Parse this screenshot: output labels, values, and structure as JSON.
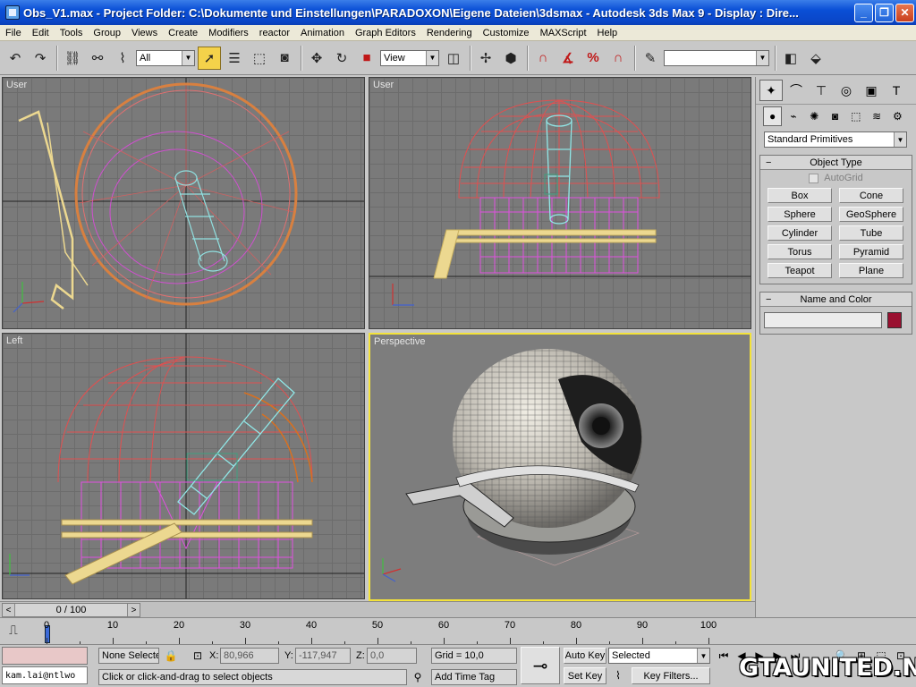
{
  "window": {
    "title": "Obs_V1.max   - Project Folder: C:\\Dokumente und Einstellungen\\PARADOXON\\Eigene Dateien\\3dsmax    - Autodesk 3ds Max 9    - Display : Dire..."
  },
  "menu": [
    "File",
    "Edit",
    "Tools",
    "Group",
    "Views",
    "Create",
    "Modifiers",
    "reactor",
    "Animation",
    "Graph Editors",
    "Rendering",
    "Customize",
    "MAXScript",
    "Help"
  ],
  "toolbar": {
    "selection_filter": "All",
    "reference_coord": "View",
    "named_selection": ""
  },
  "viewports": {
    "top_left": "User",
    "top_right": "User",
    "bottom_left": "Left",
    "bottom_right": "Perspective"
  },
  "command_panel": {
    "category_dropdown": "Standard Primitives",
    "object_type_title": "Object Type",
    "autogrid_label": "AutoGrid",
    "primitives": [
      "Box",
      "Cone",
      "Sphere",
      "GeoSphere",
      "Cylinder",
      "Tube",
      "Torus",
      "Pyramid",
      "Teapot",
      "Plane"
    ],
    "name_color_title": "Name and Color",
    "object_name": "",
    "object_color": "#9a1030"
  },
  "timeline": {
    "slider_text": "0 / 100",
    "ticks": [
      "0",
      "10",
      "20",
      "30",
      "40",
      "50",
      "60",
      "70",
      "80",
      "90",
      "100"
    ]
  },
  "status": {
    "maxscript_user": "kam.lai@ntlwo",
    "selection": "None Selecte",
    "x_label": "X:",
    "x_value": "80,966",
    "y_label": "Y:",
    "y_value": "-117,947",
    "z_label": "Z:",
    "z_value": "0,0",
    "grid": "Grid = 10,0",
    "prompt": "Click or click-and-drag to select objects",
    "add_time_tag": "Add Time Tag",
    "auto_key": "Auto Key",
    "set_key": "Set Key",
    "key_mode": "Selected",
    "key_filters": "Key Filters..."
  },
  "watermark": "GTAUNITED.NET"
}
